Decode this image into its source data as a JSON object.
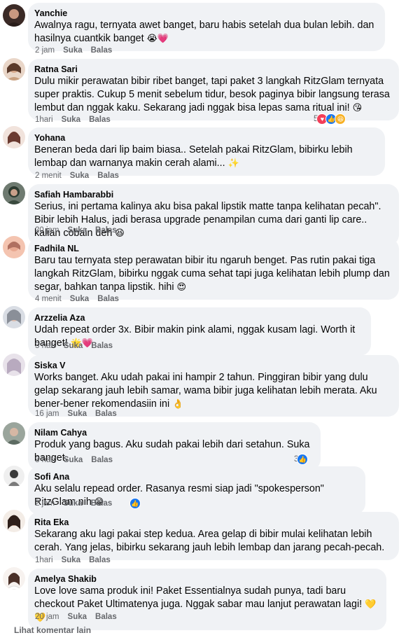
{
  "actions": {
    "like": "Suka",
    "reply": "Balas"
  },
  "comments": [
    {
      "name": "Yanchie",
      "text": "Awalnya ragu, ternyata awet banget, baru habis setelah dua bulan lebih. dan hasilnya cuantkik banget",
      "emoji": "😭💗",
      "time": "2 jam",
      "reactions": null
    },
    {
      "name": "Ratna Sari",
      "text": "Dulu mikir perawatan bibir ribet banget, tapi paket 3 langkah RitzGlam ternyata super praktis. Cukup 5 menit sebelum tidur, besok paginya bibir langsung terasa lembut dan nggak kaku. Sekarang jadi nggak bisa lepas sama ritual ini!",
      "emoji": "😘",
      "time": "1hari",
      "reactions": {
        "count": "5",
        "types": [
          "heart",
          "like",
          "haha"
        ]
      }
    },
    {
      "name": "Yohana",
      "text": "Beneran beda dari lip baim biasa.. Setelah pakai RitzGlam, bibirku lebih lembap dan warnanya makin cerah alami...",
      "emoji": "✨",
      "time": "2 menit",
      "reactions": null
    },
    {
      "name": "Safiah Hambarabbi",
      "text": "Serius, ini pertama kalinya aku bisa pakal lipstik matte tanpa kelihatan pecah\". Bibir lebih Halus, jadi berasa upgrade penampilan cuma dari ganti lip care.. kalian cobain deh",
      "emoji": "😆",
      "time": "20 jam",
      "reactions": null
    },
    {
      "name": "Fadhila NL",
      "text": "Baru tau ternyata step perawatan bibir itu ngaruh benget. Pas rutin pakai tiga langkah RitzGlam, bibirku nggak cuma sehat tapi juga kelihatan lebih plump dan segar, bahkan tanpa lipstik. hihi",
      "emoji": "😍",
      "time": "4 menit",
      "reactions": null
    },
    {
      "name": "Arzzelia Aza",
      "text": "Udah repeat order 3x. Bibir makin pink alami, nggak kusam lagi. Worth it banget!",
      "emoji": "🌟💗",
      "time": "3 hari",
      "reactions": null
    },
    {
      "name": "Siska V",
      "text": "Works banget. Aku udah pakai ini hampir 2 tahun. Pinggiran bibir yang dulu gelap sekarang jauh lebih samar, wama bibir juga kelihatan lebih merata. Aku bener-bener rekomendasiin ini",
      "emoji": "👌",
      "time": "16 jam",
      "reactions": null
    },
    {
      "name": "Nilam Cahya",
      "text": "Produk yang bagus. Aku sudah pakai lebih dari setahun. Suka banget.",
      "emoji": "",
      "time": "3 hari",
      "reactions": {
        "count": "3",
        "types": [
          "like"
        ]
      }
    },
    {
      "name": "Sofi Ana",
      "text": "Aku selalu repead order. Rasanya resmi siap jadi \"spokesperson\" RitzGlam nih",
      "emoji": "😁",
      "time": "2 jam",
      "reactions": {
        "count": "",
        "types": [
          "like"
        ]
      }
    },
    {
      "name": "Rita Eka",
      "text": "Sekarang aku lagi pakai step kedua. Area gelap di bibir mulai kelihatan lebih cerah. Yang jelas, bibirku sekarang jauh lebih lembap dan jarang pecah-pecah.",
      "emoji": "",
      "time": "1hari",
      "reactions": null
    },
    {
      "name": "Amelya Shakib",
      "text": "Love love sama produk ini! Paket Essentialnya sudah punya, tadi baru checkout Paket Ultimatenya juga. Nggak sabar mau lanjut perawatan lagi!",
      "emoji": "💛💛",
      "time": "20 jam",
      "reactions": null
    }
  ],
  "more_comments": "Lihat komentar lain",
  "colors": {
    "bubble": "#f0f2f5",
    "meta": "#65676b",
    "like": "#1877f2",
    "heart": "#f33e58"
  }
}
